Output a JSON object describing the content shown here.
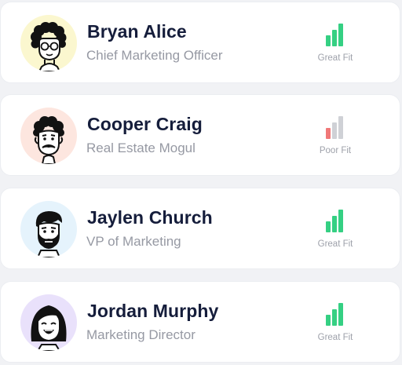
{
  "contacts": [
    {
      "name": "Bryan Alice",
      "title": "Chief Marketing Officer",
      "avatar_icon": "curly-hair-glasses-avatar-icon",
      "avatar_bg": "#fbf7cf",
      "fit": {
        "label": "Great Fit",
        "level": 3,
        "max_level": 3,
        "color": "#35d083"
      }
    },
    {
      "name": "Cooper Craig",
      "title": "Real Estate Mogul",
      "avatar_icon": "mustache-man-avatar-icon",
      "avatar_bg": "#fde6df",
      "fit": {
        "label": "Poor Fit",
        "level": 1,
        "max_level": 3,
        "color": "#f07878",
        "empty_color": "#cfd1d6"
      }
    },
    {
      "name": "Jaylen Church",
      "title": "VP of Marketing",
      "avatar_icon": "bearded-man-avatar-icon",
      "avatar_bg": "#e5f3fc",
      "fit": {
        "label": "Great Fit",
        "level": 3,
        "max_level": 3,
        "color": "#35d083"
      }
    },
    {
      "name": "Jordan Murphy",
      "title": "Marketing Director",
      "avatar_icon": "laughing-woman-avatar-icon",
      "avatar_bg": "#e9e1fb",
      "fit": {
        "label": "Great Fit",
        "level": 3,
        "max_level": 3,
        "color": "#35d083"
      }
    }
  ]
}
